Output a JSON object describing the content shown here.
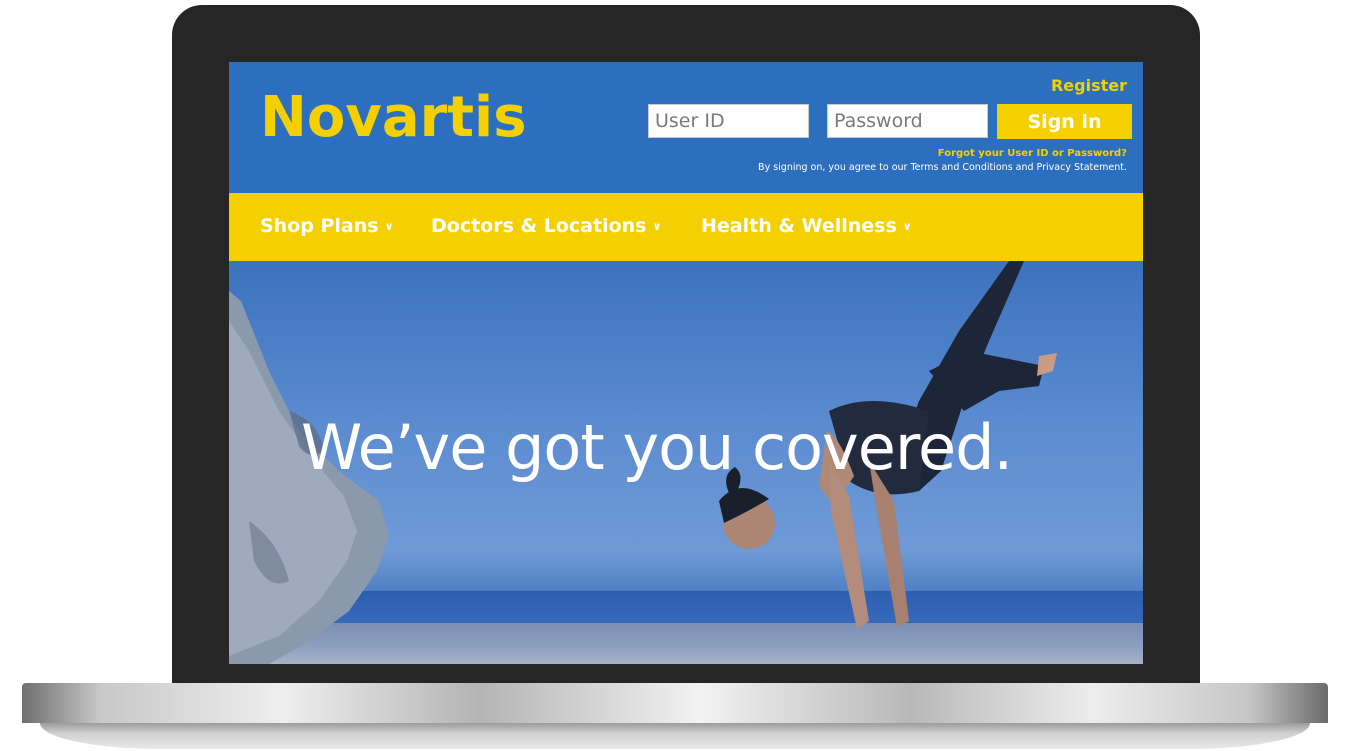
{
  "brand": {
    "name": "Novartis"
  },
  "auth": {
    "register_label": "Register",
    "userid_placeholder": "User ID",
    "password_placeholder": "Password",
    "signin_label": "Sign in",
    "forgot_label": "Forgot your User ID or Password?",
    "terms_text": "By signing on, you agree to our Terms and Conditions and Privacy Statement."
  },
  "nav": {
    "items": [
      {
        "label": "Shop Plans",
        "icon": "chevron-down-icon"
      },
      {
        "label": "Doctors & Locations",
        "icon": "chevron-down-icon"
      },
      {
        "label": "Health & Wellness",
        "icon": "chevron-down-icon"
      }
    ]
  },
  "hero": {
    "headline": "We’ve got you covered."
  },
  "colors": {
    "header_blue": "#2d6fbf",
    "brand_yellow": "#f5d000",
    "bezel": "#262626"
  }
}
